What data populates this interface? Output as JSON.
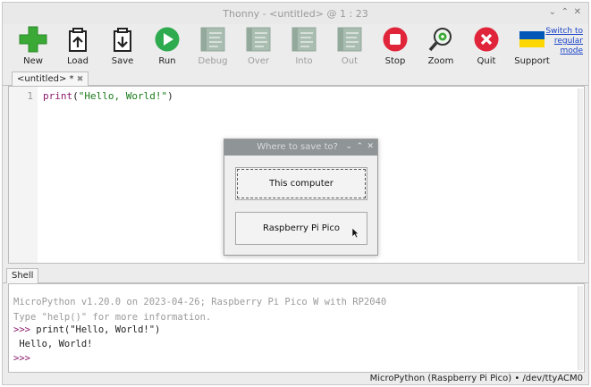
{
  "window": {
    "title": "Thonny  -  <untitled>  @  1 : 23",
    "controls": [
      "⌄",
      "⌃",
      "✕"
    ]
  },
  "toolbar": {
    "buttons": [
      {
        "label": "New",
        "icon": "plus-icon"
      },
      {
        "label": "Load",
        "icon": "load-icon"
      },
      {
        "label": "Save",
        "icon": "save-icon"
      },
      {
        "label": "Run",
        "icon": "run-icon"
      },
      {
        "label": "Debug",
        "icon": "debug-icon"
      },
      {
        "label": "Over",
        "icon": "step-over-icon"
      },
      {
        "label": "Into",
        "icon": "step-into-icon"
      },
      {
        "label": "Out",
        "icon": "step-out-icon"
      },
      {
        "label": "Stop",
        "icon": "stop-icon"
      },
      {
        "label": "Zoom",
        "icon": "zoom-icon"
      },
      {
        "label": "Quit",
        "icon": "quit-icon"
      },
      {
        "label": "Support",
        "icon": "ukraine-flag-icon"
      }
    ],
    "switch_mode_link": "Switch to regular mode"
  },
  "editor": {
    "tab_label": "<untitled> *",
    "tab_close": "✖",
    "line_number": "1",
    "code": {
      "fn": "print",
      "open": "(",
      "str": "\"Hello, World!\"",
      "close": ")"
    }
  },
  "dialog": {
    "title": "Where to save to?",
    "controls": [
      "⌄",
      "⌃",
      "✕"
    ],
    "option_computer": "This computer",
    "option_pico": "Raspberry Pi Pico"
  },
  "shell": {
    "tab_label": "Shell",
    "banner_line1": "MicroPython v1.20.0 on 2023-04-26; Raspberry Pi Pico W with RP2040",
    "banner_line2": "Type \"help()\" for more information.",
    "prompt": ">>>",
    "command": " print(\"Hello, World!\")",
    "output": " Hello, World!"
  },
  "statusbar": {
    "interpreter": "MicroPython (Raspberry Pi Pico)  •  /dev/ttyACM0"
  },
  "colors": {
    "new_green": "#3aa935",
    "run_green": "#2eaa4f",
    "stop_red": "#e0243a",
    "quit_red": "#e0243a",
    "flag_blue": "#0057b7",
    "flag_yellow": "#ffd700"
  }
}
